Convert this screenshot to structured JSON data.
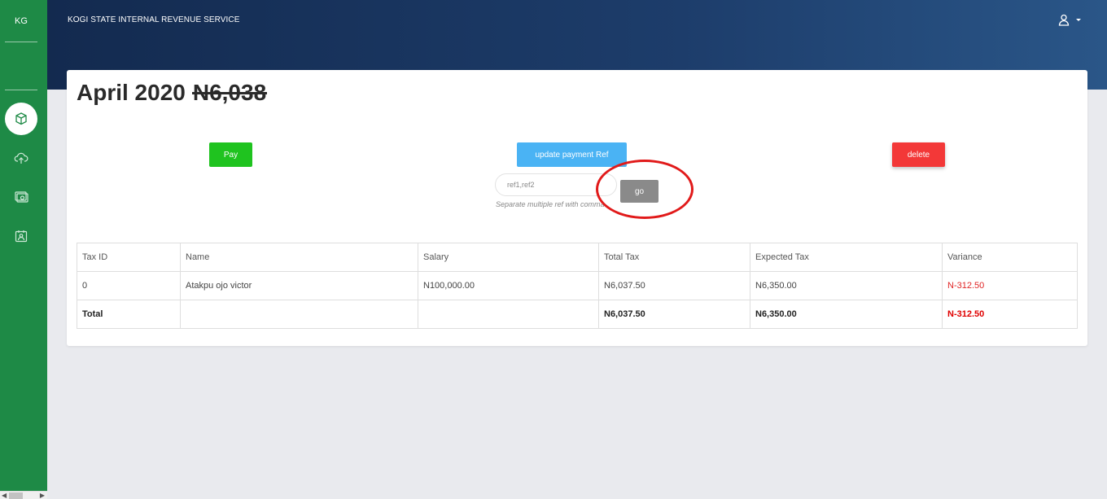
{
  "sidebar": {
    "brand": "KG",
    "items": [
      {
        "icon": "cube-icon",
        "active": true
      },
      {
        "icon": "cloud-upload-icon",
        "active": false
      },
      {
        "icon": "money-bill-icon",
        "active": false
      },
      {
        "icon": "calendar-user-icon",
        "active": false
      }
    ]
  },
  "header": {
    "org_name": "KOGI STATE INTERNAL REVENUE SERVICE",
    "user_icon": "user-icon"
  },
  "page": {
    "title": "April 2020",
    "amount": "N6,038"
  },
  "actions": {
    "pay_label": "Pay",
    "update_ref_label": "update payment Ref",
    "delete_label": "delete",
    "go_label": "go",
    "ref_placeholder": "ref1,ref2",
    "ref_hint": "Separate multiple ref with comma"
  },
  "table": {
    "headers": [
      "Tax ID",
      "Name",
      "Salary",
      "Total Tax",
      "Expected Tax",
      "Variance"
    ],
    "rows": [
      [
        "0",
        "Atakpu ojo victor",
        "N100,000.00",
        "N6,037.50",
        "N6,350.00",
        "N-312.50"
      ]
    ],
    "total": [
      "Total",
      "",
      "",
      "N6,037.50",
      "N6,350.00",
      "N-312.50"
    ]
  },
  "colors": {
    "sidebar": "#1e8a46",
    "pay": "#1fc31f",
    "update": "#4ab3f4",
    "delete": "#f33838",
    "go": "#8a8a8a",
    "annotation": "#e11a1a",
    "negative": "#e02424"
  }
}
